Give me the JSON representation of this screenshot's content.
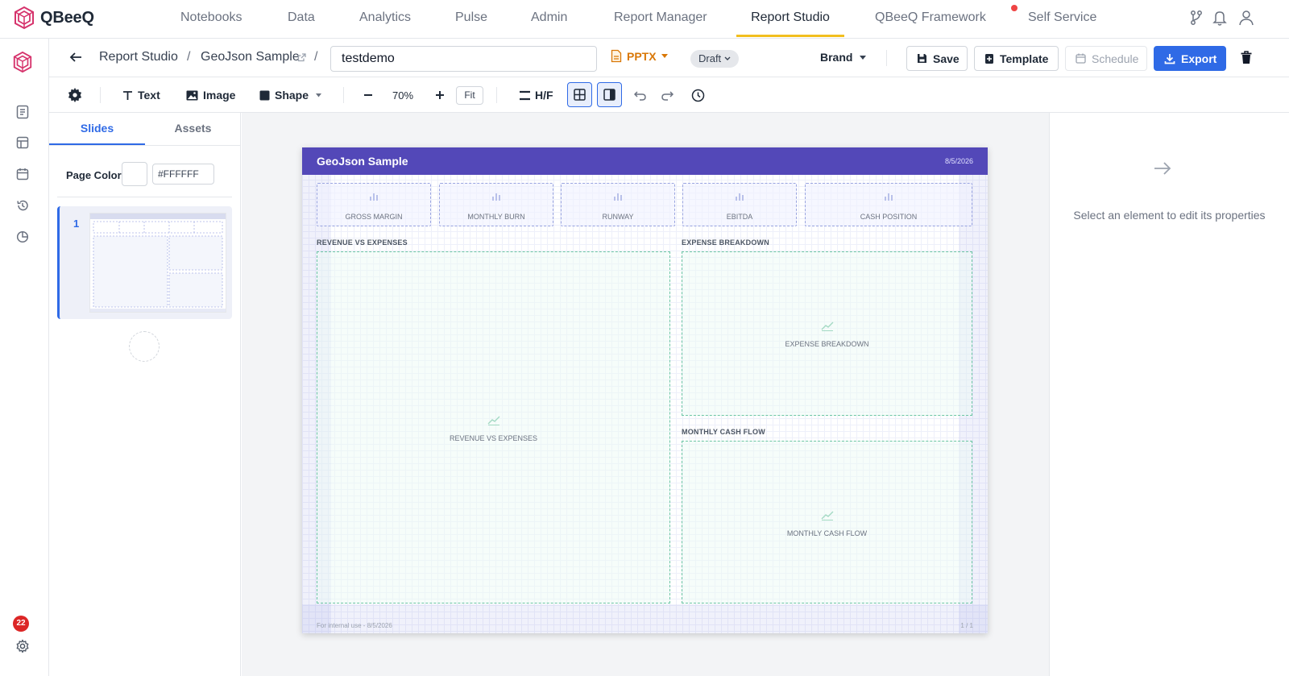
{
  "brand": {
    "name": "QBeeQ"
  },
  "nav": {
    "items": [
      {
        "label": "Notebooks"
      },
      {
        "label": "Data"
      },
      {
        "label": "Analytics"
      },
      {
        "label": "Pulse"
      },
      {
        "label": "Admin"
      },
      {
        "label": "Report Manager"
      },
      {
        "label": "Report Studio"
      },
      {
        "label": "QBeeQ Framework"
      },
      {
        "label": "Self Service"
      }
    ],
    "active": "Report Studio"
  },
  "rail": {
    "badge_count": "22"
  },
  "header": {
    "breadcrumb_root": "Report Studio",
    "breadcrumb_sep": "/",
    "breadcrumb_report": "GeoJson Sample",
    "name_value": "testdemo",
    "format": "PPTX",
    "status": "Draft",
    "brand_label": "Brand",
    "save": "Save",
    "template": "Template",
    "schedule": "Schedule",
    "export": "Export"
  },
  "toolbar": {
    "text": "Text",
    "image": "Image",
    "shape": "Shape",
    "zoom": "70%",
    "fit": "Fit",
    "hf": "H/F"
  },
  "panel": {
    "tabs": [
      {
        "label": "Slides"
      },
      {
        "label": "Assets"
      }
    ],
    "page_color_label": "Page Color",
    "page_color_value": "#FFFFFF",
    "slides": [
      {
        "number": "1"
      }
    ]
  },
  "slide": {
    "title": "GeoJson Sample",
    "date": "8/5/2026",
    "kpis": [
      {
        "label": "GROSS MARGIN"
      },
      {
        "label": "MONTHLY BURN"
      },
      {
        "label": "RUNWAY"
      },
      {
        "label": "EBITDA"
      },
      {
        "label": "CASH POSITION"
      }
    ],
    "sections": [
      {
        "heading": "REVENUE VS EXPENSES",
        "placeholder": "REVENUE VS EXPENSES"
      },
      {
        "heading": "EXPENSE BREAKDOWN",
        "placeholder": "EXPENSE BREAKDOWN"
      },
      {
        "heading": "MONTHLY CASH FLOW",
        "placeholder": "MONTHLY CASH FLOW"
      }
    ],
    "footer_left": "For internal use - 8/5/2026",
    "footer_right": "1 / 1"
  },
  "props": {
    "empty_message": "Select an element to edit its properties"
  },
  "colors": {
    "accent": "#2f6ae6",
    "nav_active_underline": "#f2bf1f",
    "slide_header": "#5348b8",
    "pptx": "#d97706",
    "badge": "#dc2626",
    "chart_placeholder_border": "#6cc6a4",
    "kpi_placeholder_border": "#9aa5e0"
  },
  "icons": [
    "logo-cube-icon",
    "branch-icon",
    "bell-icon",
    "user-icon",
    "back-arrow-icon",
    "external-link-icon",
    "file-icon",
    "save-icon",
    "template-icon",
    "calendar-icon",
    "download-icon",
    "trash-icon",
    "gear-icon",
    "text-icon",
    "image-icon",
    "shape-icon",
    "minus-icon",
    "plus-icon",
    "header-footer-icon",
    "grid-icon",
    "panel-icon",
    "undo-icon",
    "redo-icon",
    "history-icon",
    "document-icon",
    "layout-icon",
    "calendar-icon",
    "history-icon",
    "pie-icon",
    "bar-chart-icon",
    "line-chart-icon",
    "arrow-right-icon"
  ]
}
